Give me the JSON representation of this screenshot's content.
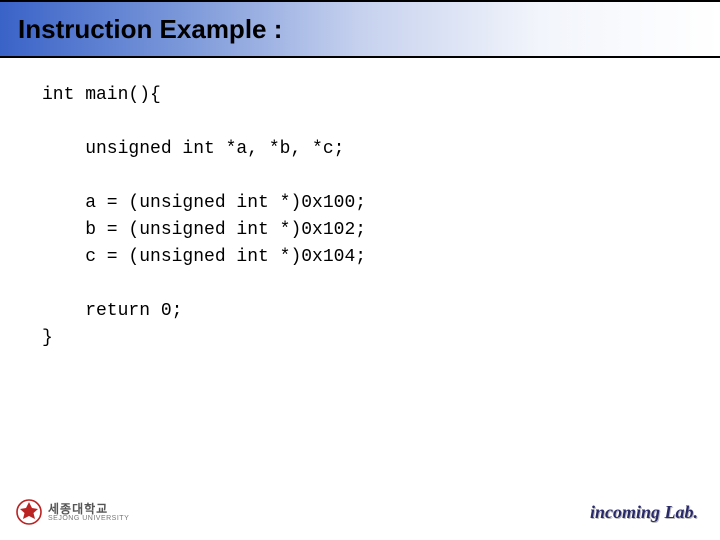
{
  "title": "Instruction Example :",
  "code": {
    "l1": "int main(){",
    "l2": "",
    "l3": "    unsigned int *a, *b, *c;",
    "l4": "",
    "l5": "    a = (unsigned int *)0x100;",
    "l6": "    b = (unsigned int *)0x102;",
    "l7": "    c = (unsigned int *)0x104;",
    "l8": "",
    "l9": "    return 0;",
    "l10": "}"
  },
  "footer": {
    "univ_kr": "세종대학교",
    "univ_en": "SEJONG UNIVERSITY",
    "lab": "incoming Lab."
  },
  "colors": {
    "band_start": "#3a63c8",
    "lab_color": "#2a2a6a"
  }
}
